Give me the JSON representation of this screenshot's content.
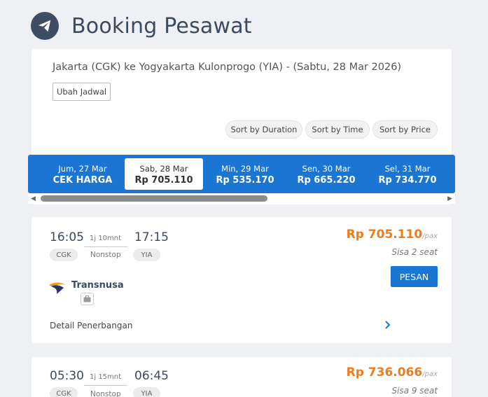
{
  "page": {
    "title": "Booking Pesawat"
  },
  "search": {
    "route": "Jakarta (CGK) ke Yogyakarta Kulonprogo (YIA) - (Sabtu, 28 Mar 2026)",
    "change_schedule": "Ubah Jadwal"
  },
  "sort": {
    "duration": "Sort by Duration",
    "time": "Sort by Time",
    "price": "Sort by Price"
  },
  "dates": [
    {
      "day": "Jum, 27 Mar",
      "price": "CEK HARGA",
      "active": false
    },
    {
      "day": "Sab, 28 Mar",
      "price": "Rp 705.110",
      "active": true
    },
    {
      "day": "Min, 29 Mar",
      "price": "Rp 535.170",
      "active": false
    },
    {
      "day": "Sen, 30 Mar",
      "price": "Rp 665.220",
      "active": false
    },
    {
      "day": "Sel, 31 Mar",
      "price": "Rp 734.770",
      "active": false
    }
  ],
  "flights": [
    {
      "depart": "16:05",
      "arrive": "17:15",
      "duration": "1j 10mnt",
      "from": "CGK",
      "to": "YIA",
      "stops": "Nonstop",
      "price": "Rp 705.110",
      "pax": "/pax",
      "seats": "Sisa 2 seat",
      "book": "PESAN",
      "airline": "Transnusa",
      "detail": "Detail Penerbangan"
    },
    {
      "depart": "05:30",
      "arrive": "06:45",
      "duration": "1j 15mnt",
      "from": "CGK",
      "to": "YIA",
      "stops": "Nonstop",
      "price": "Rp 736.066",
      "pax": "/pax",
      "seats": "Sisa 9 seat"
    }
  ],
  "colors": {
    "accent": "#1a76d2",
    "price": "#f07b18",
    "header_logo": "#3d4d63"
  }
}
